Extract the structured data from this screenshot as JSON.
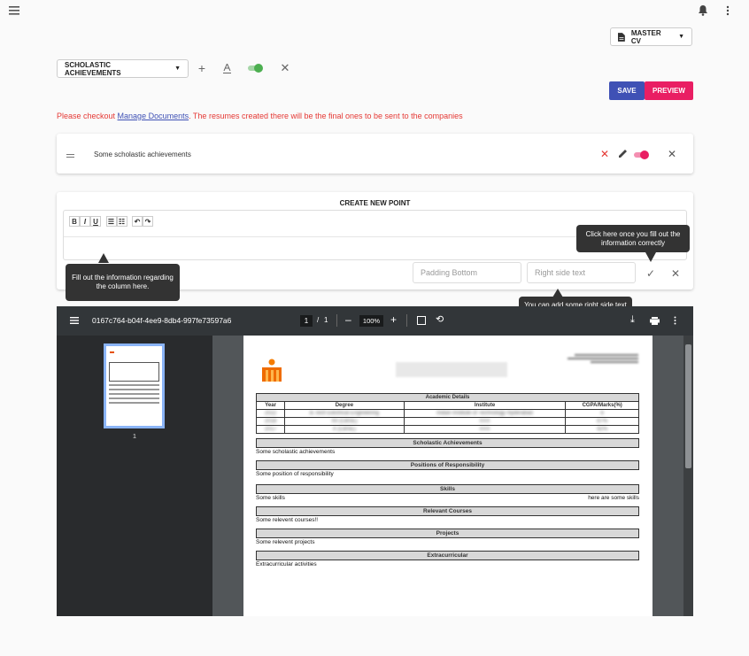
{
  "header": {
    "menu_icon": "hamburger-icon",
    "bell_icon": "bell-icon",
    "more_icon": "more-vert-icon"
  },
  "cv_selector": {
    "label": "MASTER CV",
    "icon": "document-icon"
  },
  "section_selector": {
    "label": "SCHOLASTIC ACHIEVEMENTS"
  },
  "actions": {
    "save": "SAVE",
    "preview": "PREVIEW"
  },
  "notice": {
    "prefix": "Please checkout ",
    "link": "Manage Documents",
    "suffix": ". The resumes created there will be the final ones to be sent to the companies"
  },
  "existing_point": {
    "text": "Some scholastic achievements"
  },
  "create_point": {
    "title": "CREATE NEW POINT",
    "toolbar": {
      "bold": "B",
      "italic": "I",
      "underline": "U"
    },
    "padding_placeholder": "Padding Bottom",
    "right_text_placeholder": "Right side text"
  },
  "tooltips": {
    "fill_info": "Fill out the information regarding the column here.",
    "click_here": "Click here once you fill out the information correctly",
    "right_side": "You can add some right side text here"
  },
  "viewer": {
    "filename": "0167c764-b04f-4ee9-8db4-997fe73597a6",
    "page_current": "1",
    "page_sep": "/",
    "page_total": "1",
    "zoom": "100%",
    "thumb_page": "1"
  },
  "pdf": {
    "academic_title": "Academic Details",
    "columns": [
      "Year",
      "Degree",
      "Institute",
      "CGPA/Marks(%)"
    ],
    "rows": [
      [
        "2022",
        "B.Tech Electrical Engineering",
        "Indian Institute of Technology Hyderabad",
        "8"
      ],
      [
        "2018",
        "XII (CBSE)",
        "XXX",
        "87%"
      ],
      [
        "2017",
        "X (CBSE)",
        "XXX",
        "92%"
      ]
    ],
    "sections": [
      {
        "title": "Scholastic Achievements",
        "left": "Some scholastic achievements",
        "right": ""
      },
      {
        "title": "Positions of Responsibility",
        "left": "Some position of responsibility",
        "right": ""
      },
      {
        "title": "Skills",
        "left": "Some skills",
        "right": "here are some skills"
      },
      {
        "title": "Relevant Courses",
        "left": "Some relevent courses!!",
        "right": ""
      },
      {
        "title": "Projects",
        "left": "Some relevent projects",
        "right": ""
      },
      {
        "title": "Extracurricular",
        "left": "Extracurricular activities",
        "right": ""
      }
    ]
  },
  "colors": {
    "save": "#3f51b5",
    "preview": "#e91e63",
    "toggle_green": "#4caf50",
    "toggle_pink": "#e91e63",
    "notice": "#e53935"
  }
}
